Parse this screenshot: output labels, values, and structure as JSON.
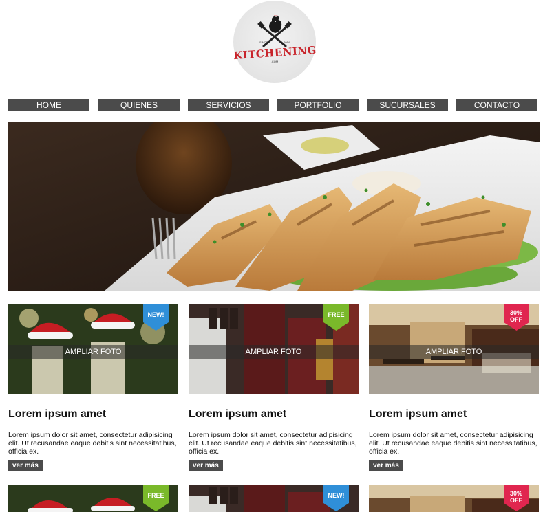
{
  "logo": {
    "name": "KITCHENING",
    "since": "SINCE",
    "year": "2014",
    "dotcom": ".COM"
  },
  "nav": [
    "HOME",
    "QUIENES",
    "SERVICIOS",
    "PORTFOLIO",
    "SUCURSALES",
    "CONTACTO"
  ],
  "cards": [
    {
      "overlay": "AMPLIAR FOTO",
      "badge": "NEW!",
      "title": "Lorem ipsum amet",
      "text": "Lorem ipsum dolor sit amet, consectetur adipisicing elit. Ut recusandae eaque debitis sint necessitatibus, officia ex.",
      "button": "ver más"
    },
    {
      "overlay": "AMPLIAR FOTO",
      "badge": "FREE",
      "title": "Lorem ipsum amet",
      "text": "Lorem ipsum dolor sit amet, consectetur adipisicing elit. Ut recusandae eaque debitis sint necessitatibus, officia ex.",
      "button": "ver más"
    },
    {
      "overlay": "AMPLIAR FOTO",
      "badge": "30% OFF",
      "title": "Lorem ipsum amet",
      "text": "Lorem ipsum dolor sit amet, consectetur adipisicing elit. Ut recusandae eaque debitis sint necessitatibus, officia ex.",
      "button": "ver más"
    }
  ],
  "cards_row2": [
    {
      "badge": "FREE"
    },
    {
      "badge": "NEW!"
    },
    {
      "badge": "30% OFF"
    }
  ],
  "colors": {
    "nav_bg": "#4b4b4b",
    "badge_new": "#2f8fd8",
    "badge_free": "#7ab92a",
    "badge_off": "#e0264f",
    "logo_red": "#c8242b"
  }
}
